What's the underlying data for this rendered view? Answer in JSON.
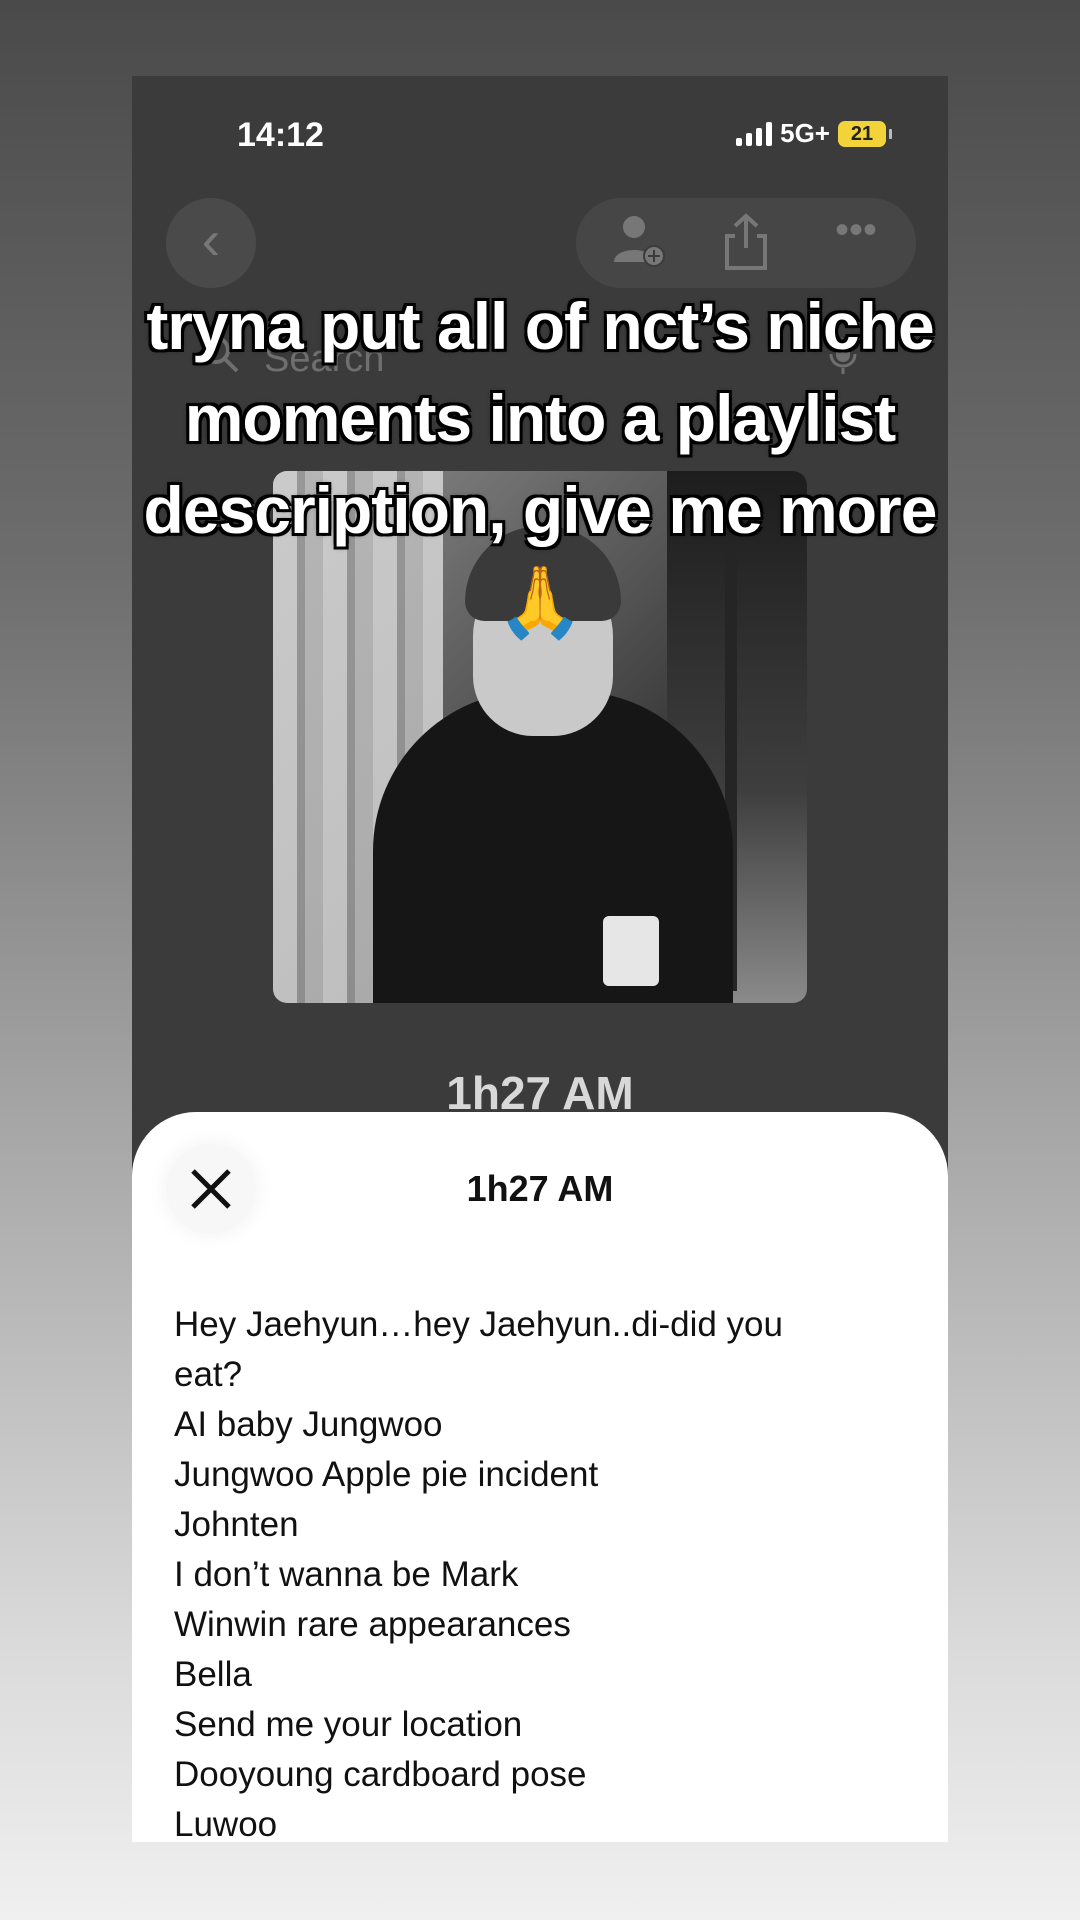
{
  "status_bar": {
    "time": "14:12",
    "network": "5G+",
    "battery": "21"
  },
  "nav": {
    "back_icon": "chevron-left-icon",
    "actions": [
      "add-person-icon",
      "share-icon",
      "more-icon"
    ]
  },
  "search": {
    "placeholder": "Search"
  },
  "playlist": {
    "title": "1h27 AM"
  },
  "sheet": {
    "title": "1h27 AM",
    "description": [
      "Hey Jaehyun…hey Jaehyun..di-did you",
      "eat?",
      "AI baby Jungwoo",
      "Jungwoo Apple pie incident",
      "Johnten",
      "I don’t wanna be Mark",
      "Winwin rare appearances",
      "Bella",
      "Send me your location",
      "Dooyoung cardboard pose",
      "Luwoo"
    ]
  },
  "overlay": {
    "lines": [
      "tryna put all of nct’s niche",
      "moments into a playlist",
      "description, give me more"
    ],
    "emoji": "🙏"
  }
}
